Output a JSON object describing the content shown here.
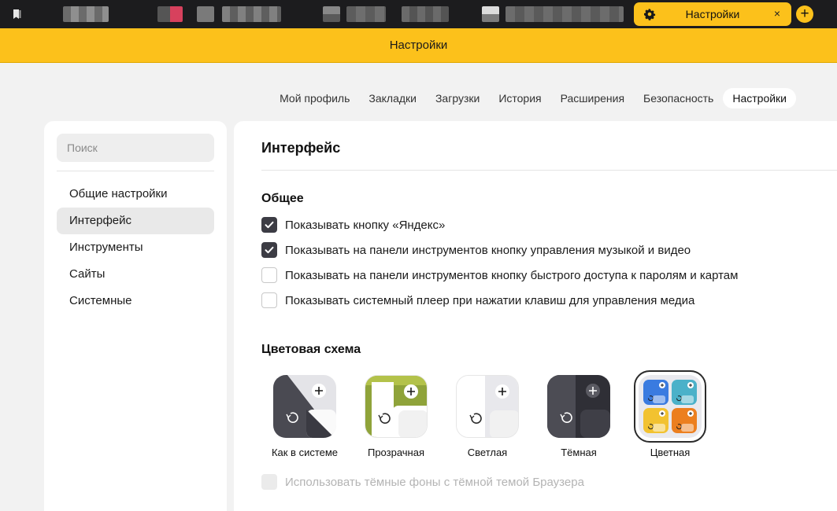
{
  "tabstrip": {
    "active_tab": {
      "label": "Настройки",
      "icon": "gear-icon",
      "close": "×"
    },
    "new_tab": "+"
  },
  "header": {
    "title": "Настройки"
  },
  "nav": {
    "tabs": [
      {
        "label": "Мой профиль",
        "active": false
      },
      {
        "label": "Закладки",
        "active": false
      },
      {
        "label": "Загрузки",
        "active": false
      },
      {
        "label": "История",
        "active": false
      },
      {
        "label": "Расширения",
        "active": false
      },
      {
        "label": "Безопасность",
        "active": false
      },
      {
        "label": "Настройки",
        "active": true
      }
    ]
  },
  "sidebar": {
    "search_placeholder": "Поиск",
    "items": [
      {
        "label": "Общие настройки",
        "active": false
      },
      {
        "label": "Интерфейс",
        "active": true
      },
      {
        "label": "Инструменты",
        "active": false
      },
      {
        "label": "Сайты",
        "active": false
      },
      {
        "label": "Системные",
        "active": false
      }
    ]
  },
  "main": {
    "title": "Интерфейс",
    "general": {
      "title": "Общее",
      "options": [
        {
          "label": "Показывать кнопку «Яндекс»",
          "checked": true
        },
        {
          "label": "Показывать на панели инструментов кнопку управления музыкой и видео",
          "checked": true
        },
        {
          "label": "Показывать на панели инструментов кнопку быстрого доступа к паролям и картам",
          "checked": false
        },
        {
          "label": "Показывать системный плеер при нажатии клавиш для управления медиа",
          "checked": false
        }
      ]
    },
    "color_scheme": {
      "title": "Цветовая схема",
      "themes": [
        {
          "label": "Как в системе",
          "selected": false
        },
        {
          "label": "Прозрачная",
          "selected": false
        },
        {
          "label": "Светлая",
          "selected": false
        },
        {
          "label": "Тёмная",
          "selected": false
        },
        {
          "label": "Цветная",
          "selected": true
        }
      ],
      "dark_bg_option": {
        "label": "Использовать тёмные фоны с тёмной темой Браузера",
        "checked": false,
        "disabled": true
      }
    }
  },
  "colors": {
    "accent": "#fcc11b",
    "tabstrip": "#1c1c1e",
    "page_bg": "#f2f2f2",
    "checkbox_checked": "#3c3c44"
  }
}
